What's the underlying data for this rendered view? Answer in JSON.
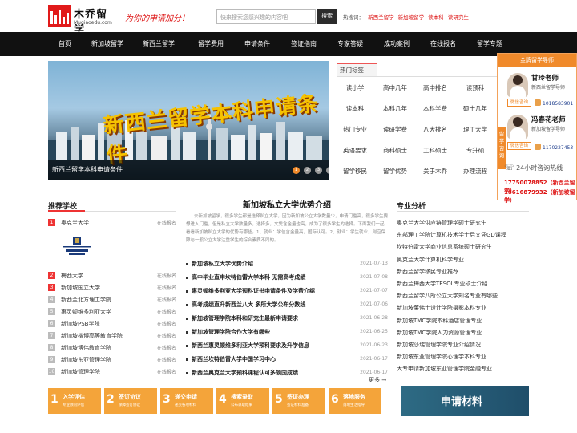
{
  "header": {
    "logo_text": "木乔留学",
    "logo_sub": "Muqiaoedu.com",
    "slogan": "为你的申请加分！",
    "search_placeholder": "快来搜索您感兴趣的内容吧",
    "search_button": "搜索",
    "hot_label": "热搜词：",
    "hot_keywords": [
      "新西兰留学",
      "新加坡留学",
      "读本科",
      "读研究生"
    ]
  },
  "nav": [
    "首页",
    "新加坡留学",
    "新西兰留学",
    "留学费用",
    "申请条件",
    "签证指南",
    "专家答疑",
    "成功案例",
    "在线报名",
    "留学专题"
  ],
  "banner": {
    "title": "新西兰留学本科申请条件",
    "caption": "新西兰留学本科申请条件",
    "dots": [
      "1",
      "2",
      "3",
      "4",
      "5",
      "6"
    ]
  },
  "hot_tags": {
    "title": "热门标签",
    "items": [
      "读小学",
      "高中几年",
      "高中排名",
      "读预科",
      "读本科",
      "本科几年",
      "本科学费",
      "硕士几年",
      "热门专业",
      "读研学费",
      "八大排名",
      "理工大学",
      "英语要求",
      "商科硕士",
      "工科硕士",
      "专升硕",
      "留学移民",
      "留学优势",
      "关于木乔",
      "办理流程"
    ]
  },
  "consult": {
    "title": "金牌留学导师",
    "tab": "留学咨询",
    "teachers": [
      {
        "name": "甘玲老师",
        "role": "新西兰留学导师",
        "wechat": "微信咨询",
        "qq": "1018583901"
      },
      {
        "name": "冯春花老师",
        "role": "新加坡留学导师",
        "wechat": "微信咨询",
        "qq": "1170227453"
      }
    ],
    "hotline": "24小时咨询热线",
    "phones": [
      "17750078852（新西兰留学）",
      "18616879932（新加坡留学）"
    ]
  },
  "schools": {
    "title": "推荐学校",
    "subscribe": "在线报名",
    "items": [
      "奥克兰大学",
      "梅西大学",
      "新加坡国立大学",
      "新西兰北方理工学院",
      "惠灵顿维多利亚大学",
      "新加坡PSB学院",
      "新加坡楷博高等教育学院",
      "新加坡博伟教育学院",
      "新加坡东亚管理学院",
      "新加坡管理学院"
    ]
  },
  "article": {
    "title": "新加坡私立大学优势介绍",
    "summary": "去新加坡留学，很多学生都是选择私立大学，因为新加坡公立大学数量少，申请门槛高，很多学生要想进入门槛，但是私立大学数量多，选择多，文凭含金量也高，成为了很多学生的选择。下面我们一起看看新加坡私立大学的优势有哪些。1、就业：学位含金量高，国际认可。2、就业：学生就业，则应保障与一般公立大学注重学生的综合素质不同的。",
    "news": [
      {
        "t": "新加坡私立大学优势介绍",
        "d": "2021-07-13"
      },
      {
        "t": "高中毕业直申坎特伯雷大学本科 无需高考成绩",
        "d": "2021-07-08"
      },
      {
        "t": "惠灵顿维多利亚大学预科证书申请条件及学费介绍",
        "d": "2021-07-07"
      },
      {
        "t": "高考成绩直升新西兰八大 多所大学公布分数线",
        "d": "2021-07-06"
      },
      {
        "t": "新加坡管理学院本科和研究生最新申请要求",
        "d": "2021-06-28"
      },
      {
        "t": "新加坡管理学院合作大学有哪些",
        "d": "2021-06-25"
      },
      {
        "t": "新西兰惠灵顿维多利亚大学预科要求及升学信息",
        "d": "2021-06-23"
      },
      {
        "t": "新西兰坎特伯雷大学中国学习中心",
        "d": "2021-06-17"
      },
      {
        "t": "新西兰奥克兰大学预科课程认可多领国成绩",
        "d": "2021-06-17"
      }
    ],
    "more": "更多 →"
  },
  "majors": {
    "title": "专业分析",
    "items": [
      "奥克兰大学供应链管理学硕士研究生",
      "东部理工学院计算机技术学士后文凭GD课程",
      "坎特伯雷大学商业信息系统硕士研究生",
      "奥克兰大学计算机科学专业",
      "新西兰留学移民专业推荐",
      "新西兰梅西大学TESOL专业硕士介绍",
      "新西兰留学八所公立大学知名专业有哪些",
      "新加坡莱佛士设计学院摄影本科专业",
      "新加坡TMC学院本科酒店管理专业",
      "新加坡TMC学院人力资源管理专业",
      "新加坡莎瑞管理学院专业介绍情况",
      "新加坡东亚管理学院心理学本科专业",
      "大专申请新加坡东亚管理学院金融专业"
    ]
  },
  "steps": [
    {
      "n": "1",
      "l": "入学评估",
      "s": "专业顾问评估"
    },
    {
      "n": "2",
      "l": "签订协议",
      "s": "保障签订协议"
    },
    {
      "n": "3",
      "l": "递交申请",
      "s": "递交各项材料"
    },
    {
      "n": "4",
      "l": "搜索录取",
      "s": "公布录取结果"
    },
    {
      "n": "5",
      "l": "签证办理",
      "s": "签证材料准备"
    },
    {
      "n": "6",
      "l": "落地服务",
      "s": "落地生活指导"
    }
  ],
  "apply_banner": "申请材料"
}
